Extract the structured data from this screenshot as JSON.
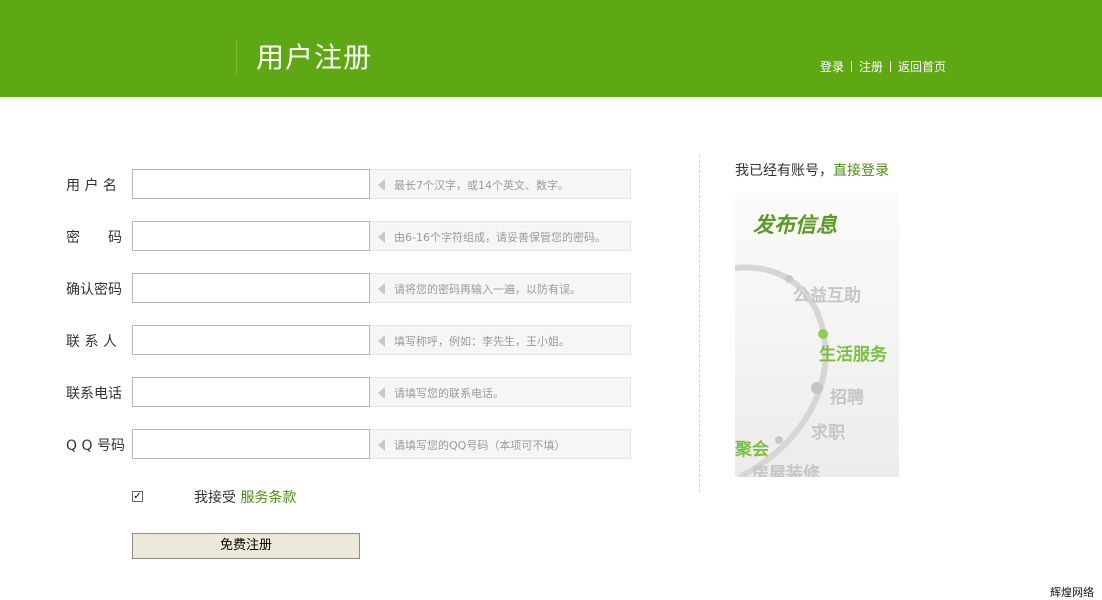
{
  "header": {
    "title": "用户注册",
    "nav": {
      "login": "登录",
      "register": "注册",
      "home": "返回首页"
    }
  },
  "form": {
    "fields": [
      {
        "label": "用 户 名",
        "value": "",
        "hint": "最长7个汉字，或14个英文、数字。"
      },
      {
        "label": "密　　码",
        "value": "",
        "hint": "由6-16个字符组成，请妥善保管您的密码。"
      },
      {
        "label": "确认密码",
        "value": "",
        "hint": "请将您的密码再输入一遍，以防有误。"
      },
      {
        "label": "联 系 人",
        "value": "",
        "hint": "填写称呼，例如：李先生，王小姐。"
      },
      {
        "label": "联系电话",
        "value": "",
        "hint": "请填写您的联系电话。"
      },
      {
        "label": "Q Q 号码",
        "value": "",
        "hint": "请填写您的QQ号码（本项可不填）"
      }
    ],
    "agree": {
      "checked_mark": "✓",
      "prefix": "我接受 ",
      "link": "服务条款"
    },
    "submit_label": "免费注册"
  },
  "sidebar": {
    "prefix": "我已经有账号，",
    "login_link": "直接登录",
    "promo": {
      "title": "发布信息",
      "items": [
        "公益互助",
        "生活服务",
        "招聘",
        "求职",
        "聚会",
        "房屋装修"
      ]
    }
  },
  "watermark": "辉煌网络",
  "colors": {
    "brand_green": "#5ea813",
    "link_green": "#4e8f12",
    "promo_green": "#7bc043"
  }
}
